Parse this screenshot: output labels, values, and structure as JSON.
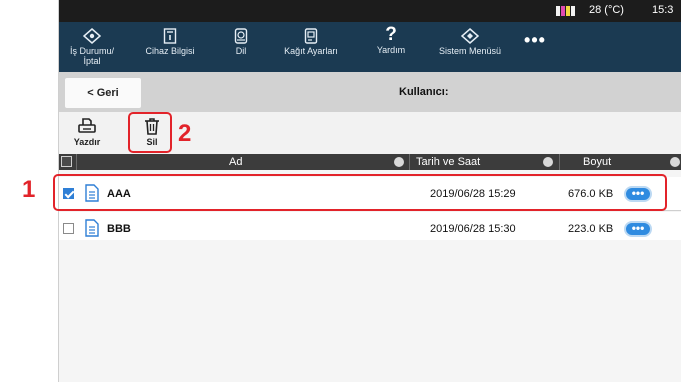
{
  "status": {
    "temperature": "28 (°C)",
    "time": "15:3",
    "ink_colors": [
      "#f2f2f2",
      "#e04bb0",
      "#f2d840",
      "#f2f2f2"
    ]
  },
  "nav": {
    "items": [
      {
        "label": "İş Durumu/\nİptal",
        "icon": "job-status-icon"
      },
      {
        "label": "Cihaz Bilgisi",
        "icon": "device-info-icon"
      },
      {
        "label": "Dil",
        "icon": "language-icon"
      },
      {
        "label": "Kağıt Ayarları",
        "icon": "paper-settings-icon"
      },
      {
        "label": "Yardım",
        "icon": "help-icon",
        "glyph": "?"
      },
      {
        "label": "Sistem Menüsü",
        "icon": "system-menu-icon"
      },
      {
        "label": "",
        "icon": "more-icon",
        "glyph": "•••"
      }
    ]
  },
  "titlebar": {
    "back_label": "< Geri",
    "title": "Kullanıcı:"
  },
  "toolbar": {
    "print_label": "Yazdır",
    "delete_label": "Sil"
  },
  "table": {
    "columns": [
      "Ad",
      "Tarih ve Saat",
      "Boyut"
    ],
    "rows": [
      {
        "name": "AAA",
        "datetime": "2019/06/28 15:29",
        "size": "676.0 KB",
        "checked": true,
        "more": "•••"
      },
      {
        "name": "BBB",
        "datetime": "2019/06/28 15:30",
        "size": "223.0 KB",
        "checked": false,
        "more": "•••"
      }
    ]
  },
  "callouts": {
    "row": "1",
    "delete": "2"
  },
  "colors": {
    "nav_bg": "#1b3a52",
    "header_bg": "#3c3c3c",
    "accent": "#2f8be0",
    "highlight": "#e2232a"
  }
}
